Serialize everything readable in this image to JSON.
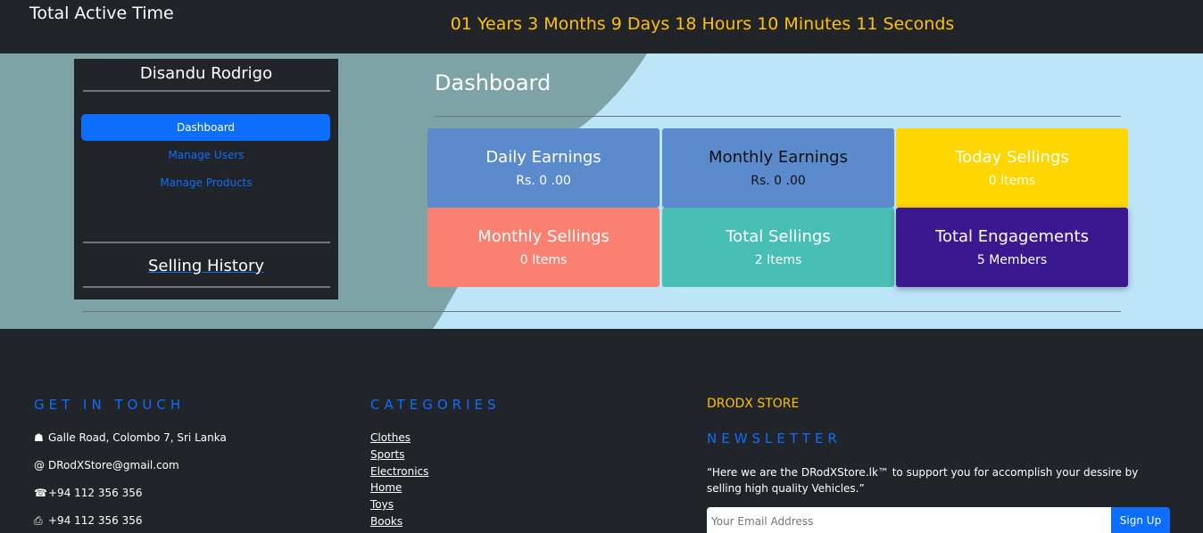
{
  "topbar": {
    "title": "Total Active Time",
    "timer": "01 Years 3 Months 9 Days 18 Hours 10 Minutes 11 Seconds"
  },
  "sidebar": {
    "user_name": "Disandu Rodrigo",
    "nav": [
      "Dashboard",
      "Manage Users",
      "Manage Products"
    ],
    "history_label": "Selling History"
  },
  "dashboard": {
    "title": "Dashboard",
    "cards": [
      {
        "title": "Daily Earnings",
        "value": "Rs. 0 .00",
        "color": "#5b8bcd"
      },
      {
        "title": "Monthly Earnings",
        "value": "Rs. 0 .00",
        "color": "#5b8bcd"
      },
      {
        "title": "Today Sellings",
        "value": "0 Items",
        "color": "#ffd700"
      },
      {
        "title": "Monthly Sellings",
        "value": "0 Items",
        "color": "#fa8072"
      },
      {
        "title": "Total Sellings",
        "value": "2 Items",
        "color": "#48bfb5"
      },
      {
        "title": "Total Engagements",
        "value": "5 Members",
        "color": "#3a1890"
      }
    ]
  },
  "footer": {
    "get_in_touch": "GET IN TOUCH",
    "contact": [
      {
        "icon": "home-icon",
        "text": "Galle Road, Colombo 7, Sri Lanka"
      },
      {
        "icon": "at-icon",
        "text": "DRodXStore@gmail.com"
      },
      {
        "icon": "phone-icon",
        "text": "+94 112 356 356"
      },
      {
        "icon": "fax-icon",
        "text": "+94 112 356 356"
      }
    ],
    "categories_title": "CATEGORIES",
    "categories": [
      "Clothes",
      "Sports",
      "Electronics",
      "Home",
      "Toys",
      "Books"
    ],
    "store_name": "DRODX STORE",
    "newsletter_title": "NEWSLETTER",
    "quote": "“Here we are the DRodXStore.lk™ to support you for accomplish your dessire by selling high quality Vehicles.”",
    "email_placeholder": "Your Email Address",
    "signup_label": "Sign Up"
  },
  "colors": {
    "accent": "#0d6efd",
    "highlight": "#ffc107",
    "dark": "#212529",
    "hero": "#bde5f8"
  }
}
